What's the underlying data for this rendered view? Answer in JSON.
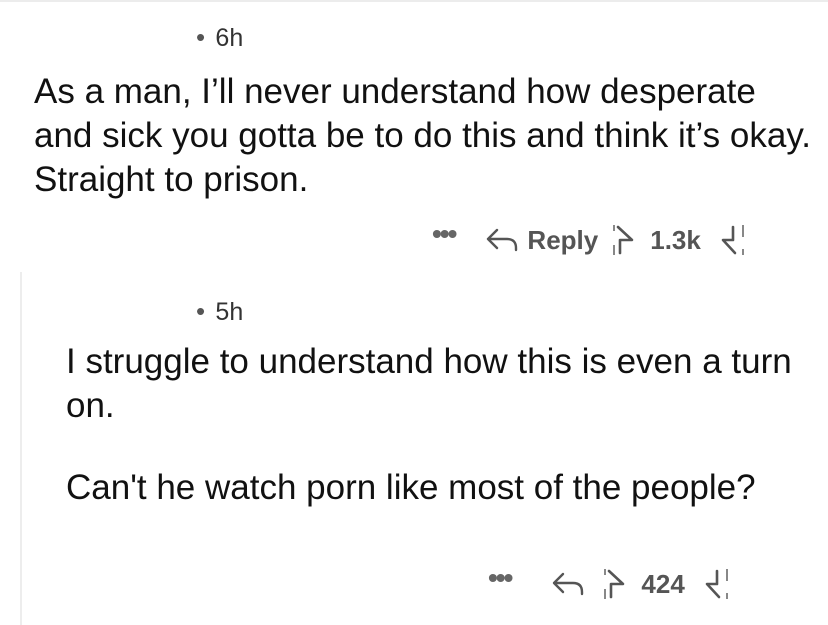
{
  "comments": [
    {
      "time": "6h",
      "body": [
        "As a man, I’ll never understand how desperate and sick you gotta be to do this and think it’s okay. Straight to prison."
      ],
      "actions": {
        "more_label": "•••",
        "reply_label": "Reply",
        "score": "1.3k"
      }
    },
    {
      "time": "5h",
      "body": [
        "I struggle to understand how this is even a turn on.",
        "Can't he watch porn like most of the people?"
      ],
      "actions": {
        "more_label": "•••",
        "reply_label": "",
        "score": "424"
      }
    }
  ],
  "icons": {
    "reply": "reply-arrow-icon",
    "upvote": "upvote-arrow-icon",
    "downvote": "downvote-arrow-icon",
    "meta_dot": "•"
  },
  "colors": {
    "text": "#111111",
    "meta": "#555555",
    "thread_line": "#ededed"
  }
}
